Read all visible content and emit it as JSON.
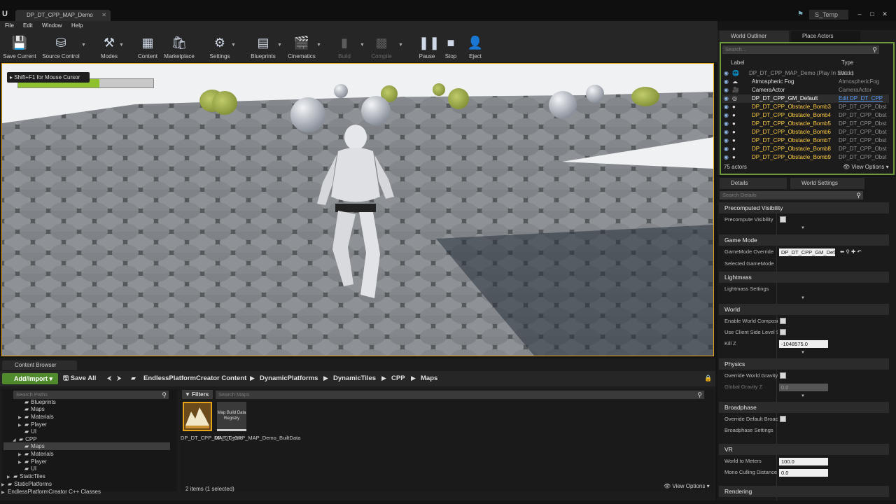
{
  "titlebar": {
    "logo": "U",
    "doc_tab": "DP_DT_CPP_MAP_Demo",
    "project": "S_Temp",
    "min": "–",
    "max": "□",
    "close": "✕"
  },
  "menu": [
    "File",
    "Edit",
    "Window",
    "Help"
  ],
  "toolbar": {
    "save_current": "Save Current",
    "source_control": "Source Control",
    "modes": "Modes",
    "content": "Content",
    "marketplace": "Marketplace",
    "settings": "Settings",
    "blueprints": "Blueprints",
    "cinematics": "Cinematics",
    "build": "Build",
    "compile": "Compile",
    "pause": "Pause",
    "stop": "Stop",
    "eject": "Eject"
  },
  "viewport": {
    "hint": "Shift+F1 for Mouse Cursor",
    "health_fraction": 0.6
  },
  "outliner": {
    "tab_outliner": "World Outliner",
    "tab_place": "Place Actors",
    "search_placeholder": "Search...",
    "col_label": "Label",
    "col_type": "Type",
    "rows": [
      {
        "label": "DP_DT_CPP_MAP_Demo (Play In Editor)",
        "type": "World"
      },
      {
        "label": "Atmospheric Fog",
        "type": "AtmosphericFog"
      },
      {
        "label": "CameraActor",
        "type": "CameraActor"
      },
      {
        "label": "DP_DT_CPP_GM_Default",
        "type": "Edit DP_DT_CPP"
      },
      {
        "label": "DP_DT_CPP_Obstacle_Bomb3",
        "type": "DP_DT_CPP_Obst"
      },
      {
        "label": "DP_DT_CPP_Obstacle_Bomb4",
        "type": "DP_DT_CPP_Obst"
      },
      {
        "label": "DP_DT_CPP_Obstacle_Bomb5",
        "type": "DP_DT_CPP_Obst"
      },
      {
        "label": "DP_DT_CPP_Obstacle_Bomb6",
        "type": "DP_DT_CPP_Obst"
      },
      {
        "label": "DP_DT_CPP_Obstacle_Bomb7",
        "type": "DP_DT_CPP_Obst"
      },
      {
        "label": "DP_DT_CPP_Obstacle_Bomb8",
        "type": "DP_DT_CPP_Obst"
      },
      {
        "label": "DP_DT_CPP_Obstacle_Bomb9",
        "type": "DP_DT_CPP_Obst"
      }
    ],
    "actor_count": "75 actors",
    "view_options": "View Options"
  },
  "details": {
    "tab_details": "Details",
    "tab_world_settings": "World Settings",
    "search_placeholder": "Search Details",
    "precomputed_visibility": "Precomputed Visibility",
    "precompute_visibility": "Precompute Visibility",
    "game_mode": "Game Mode",
    "gamemode_override": "GameMode Override",
    "gamemode_value": "DP_DT_CPP_GM_Defa",
    "selected_gamemode": "Selected GameMode",
    "lightmass": "Lightmass",
    "lightmass_settings": "Lightmass Settings",
    "world": "World",
    "enable_world_composition": "Enable World Composi",
    "use_client_side_level": "Use Client Side Level S",
    "kill_z": "Kill Z",
    "kill_z_value": "-1048575.0",
    "physics": "Physics",
    "override_world_gravity": "Override World Gravity",
    "global_gravity_z": "Global Gravity Z",
    "global_gravity_value": "0.0",
    "broadphase": "Broadphase",
    "override_default_broadphase": "Override Default Broac",
    "broadphase_settings": "Broadphase Settings",
    "vr": "VR",
    "world_to_meters": "World to Meters",
    "world_to_meters_value": "100.0",
    "mono_culling": "Mono Culling Distance",
    "mono_culling_value": "0.0",
    "rendering": "Rendering"
  },
  "content_browser": {
    "tab": "Content Browser",
    "add_import": "Add/Import",
    "save_all": "Save All",
    "breadcrumbs": [
      "EndlessPlatformCreator Content",
      "DynamicPlatforms",
      "DynamicTiles",
      "CPP",
      "Maps"
    ],
    "search_paths_placeholder": "Search Paths",
    "filters": "Filters",
    "search_maps_placeholder": "Search Maps",
    "tree": [
      "Blueprints",
      "Maps",
      "Materials",
      "Player",
      "UI",
      "CPP",
      "Maps",
      "Materials",
      "Player",
      "UI",
      "StaticTiles",
      "StaticPlatforms",
      "EndlessPlatformCreator C++ Classes"
    ],
    "asset1_label": "DP_DT_CPP_MAP_Demo",
    "asset2_thumb": "Map Build Data Registry",
    "asset2_label": "DP_DT_CPP_MAP_Demo_BuiltData",
    "status": "2 items (1 selected)",
    "view_options": "View Options"
  }
}
